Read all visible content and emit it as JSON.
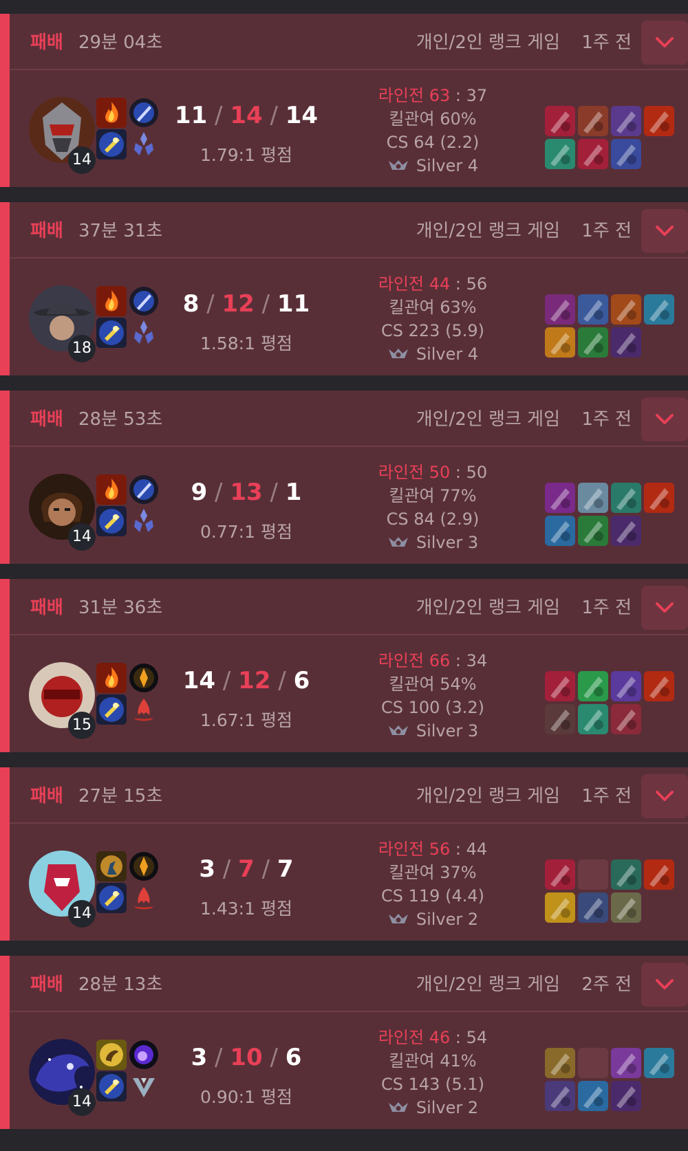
{
  "matches": [
    {
      "result": "패배",
      "duration": "29분 04초",
      "queue": "개인/2인 랭크 게임",
      "ago": "1주 전",
      "champion_icon": "warrior-helmet-champion",
      "level": "14",
      "spell_icons": [
        "ignite-icon",
        "flash-icon",
        "ghost-icon"
      ],
      "rune_icons": [
        "conqueror-rune-icon",
        "sorcery-rune-icon"
      ],
      "kills": "11",
      "deaths": "14",
      "assists": "14",
      "ratio": "1.79:1 평점",
      "lane_label": "라인전",
      "lane_win": "63",
      "lane_loss": "37",
      "kill_participation": "킬관여 60%",
      "cs": "CS 64 (2.2)",
      "tier": "Silver 4",
      "item_colors": [
        "#a3203a",
        "#8a3b2a",
        "#5a3a8c",
        "#b32a12",
        "#2a8a70",
        "#a3203a",
        "#3a4a9c",
        ""
      ]
    },
    {
      "result": "패배",
      "duration": "37분 31초",
      "queue": "개인/2인 랭크 게임",
      "ago": "1주 전",
      "champion_icon": "gunslinger-champion",
      "level": "18",
      "spell_icons": [
        "ignite-icon",
        "flash-icon",
        "ghost-icon"
      ],
      "rune_icons": [
        "conqueror-rune-icon",
        "sorcery-rune-icon"
      ],
      "kills": "8",
      "deaths": "12",
      "assists": "11",
      "ratio": "1.58:1 평점",
      "lane_label": "라인전",
      "lane_win": "44",
      "lane_loss": "56",
      "kill_participation": "킬관여 63%",
      "cs": "CS 223 (5.9)",
      "tier": "Silver 4",
      "item_colors": [
        "#7a2a7a",
        "#3a5a9c",
        "#a34a1a",
        "#2a7a9c",
        "#c07a1a",
        "#2a7a3a",
        "#4a2a6a",
        ""
      ]
    },
    {
      "result": "패배",
      "duration": "28분 53초",
      "queue": "개인/2인 랭크 게임",
      "ago": "1주 전",
      "champion_icon": "marksman-champion",
      "level": "14",
      "spell_icons": [
        "ignite-icon",
        "flash-icon",
        "ghost-icon"
      ],
      "rune_icons": [
        "conqueror-rune-icon",
        "sorcery-rune-icon"
      ],
      "kills": "9",
      "deaths": "13",
      "assists": "1",
      "ratio": "0.77:1 평점",
      "lane_label": "라인전",
      "lane_win": "50",
      "lane_loss": "50",
      "kill_participation": "킬관여 77%",
      "cs": "CS 84 (2.9)",
      "tier": "Silver 3",
      "item_colors": [
        "#7a2a8a",
        "#6a8aa0",
        "#2a7a6a",
        "#b32a12",
        "#2a6aa0",
        "#2a7a3a",
        "#4a2a6a",
        ""
      ]
    },
    {
      "result": "패배",
      "duration": "31분 36초",
      "queue": "개인/2인 랭크 게임",
      "ago": "1주 전",
      "champion_icon": "masked-fighter-champion",
      "level": "15",
      "spell_icons": [
        "ignite-icon",
        "flash-icon",
        "ghost-icon"
      ],
      "rune_icons": [
        "electrocute-rune-icon",
        "domination-rune-icon"
      ],
      "kills": "14",
      "deaths": "12",
      "assists": "6",
      "ratio": "1.67:1 평점",
      "lane_label": "라인전",
      "lane_win": "66",
      "lane_loss": "34",
      "kill_participation": "킬관여 54%",
      "cs": "CS 100 (3.2)",
      "tier": "Silver 3",
      "item_colors": [
        "#a3203a",
        "#2a9a4a",
        "#5a3a9c",
        "#b32a12",
        "#5a3a3a",
        "#2a8a70",
        "#8a2a3a",
        ""
      ]
    },
    {
      "result": "패배",
      "duration": "27분 15초",
      "queue": "개인/2인 랭크 게임",
      "ago": "1주 전",
      "champion_icon": "armored-knight-champion",
      "level": "14",
      "spell_icons": [
        "teleport-icon",
        "flash-icon",
        "ghost-icon"
      ],
      "rune_icons": [
        "electrocute-rune-icon",
        "domination-rune-icon"
      ],
      "kills": "3",
      "deaths": "7",
      "assists": "7",
      "ratio": "1.43:1 평점",
      "lane_label": "라인전",
      "lane_win": "56",
      "lane_loss": "44",
      "kill_participation": "킬관여 37%",
      "cs": "CS 119 (4.4)",
      "tier": "Silver 2",
      "item_colors": [
        "#a3203a",
        "",
        "#2a6a5a",
        "#b32a12",
        "#c0921a",
        "#3a4a7a",
        "#6a6a4a",
        ""
      ]
    },
    {
      "result": "패배",
      "duration": "28분 13초",
      "queue": "개인/2인 랭크 게임",
      "ago": "2주 전",
      "champion_icon": "cosmic-dragon-champion",
      "level": "14",
      "spell_icons": [
        "heal-icon",
        "flash-icon",
        "barrier-icon"
      ],
      "rune_icons": [
        "arcane-comet-rune-icon",
        "inspiration-rune-icon"
      ],
      "kills": "3",
      "deaths": "10",
      "assists": "6",
      "ratio": "0.90:1 평점",
      "lane_label": "라인전",
      "lane_win": "46",
      "lane_loss": "54",
      "kill_participation": "킬관여 41%",
      "cs": "CS 143 (5.1)",
      "tier": "Silver 2",
      "item_colors": [
        "#8a6a2a",
        "",
        "#7a3a9c",
        "#2a7a9c",
        "#4a3a7a",
        "#2a6aa0",
        "#4a2a6a",
        ""
      ]
    }
  ],
  "colors": {
    "loss": "#e84057",
    "card": "#592f37",
    "background": "#26262b",
    "text": "#b8a4a8"
  }
}
